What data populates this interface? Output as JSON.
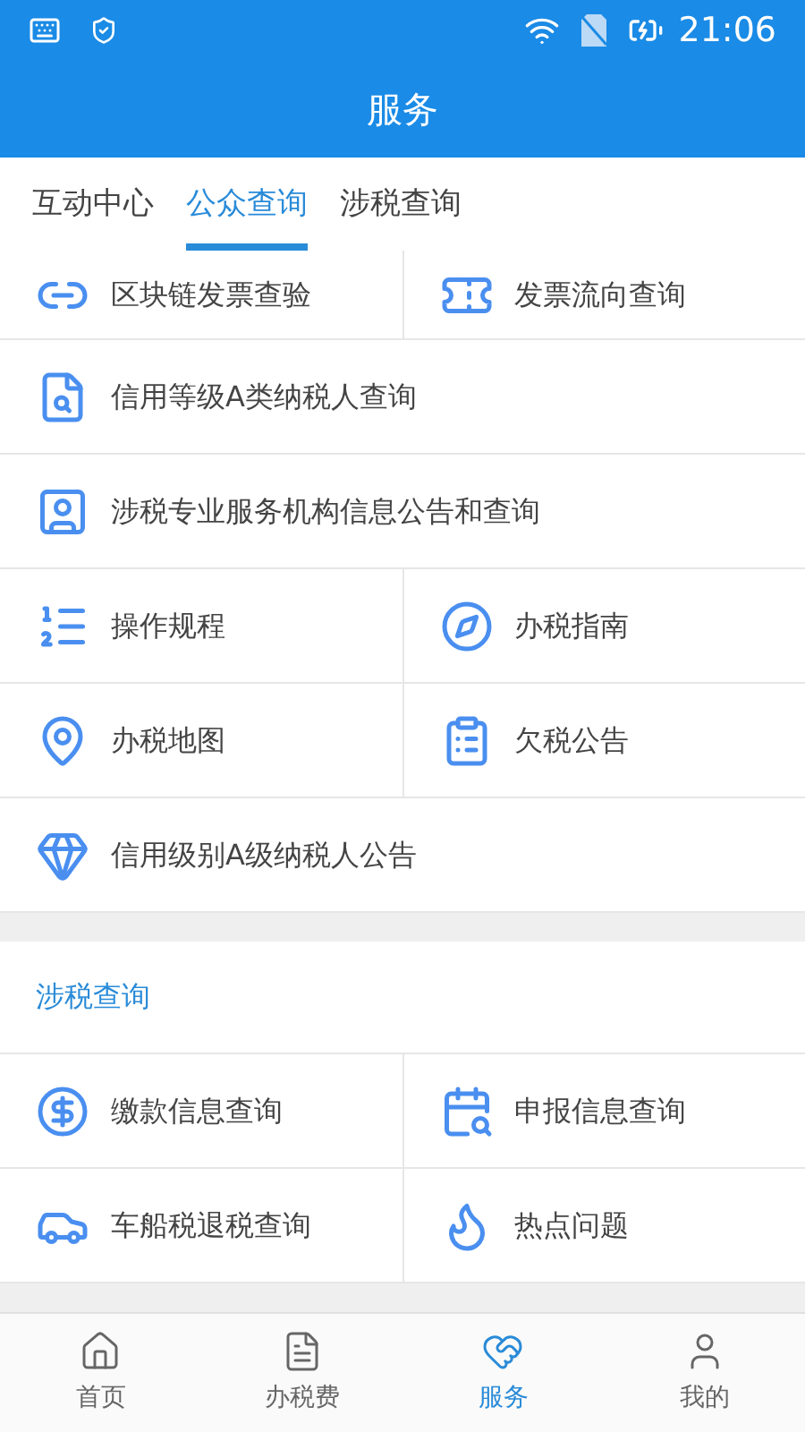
{
  "status_bar": {
    "time": "21:06"
  },
  "header": {
    "title": "服务"
  },
  "tabs": [
    {
      "label": "互动中心",
      "selected": false
    },
    {
      "label": "公众查询",
      "selected": true
    },
    {
      "label": "涉税查询",
      "selected": false
    }
  ],
  "sections": [
    {
      "rows": [
        {
          "items": [
            {
              "label": "区块链发票查验"
            },
            {
              "label": "发票流向查询"
            }
          ]
        },
        {
          "items": [
            {
              "label": "信用等级A类纳税人查询"
            }
          ]
        },
        {
          "items": [
            {
              "label": "涉税专业服务机构信息公告和查询"
            }
          ]
        },
        {
          "items": [
            {
              "label": "操作规程"
            },
            {
              "label": "办税指南"
            }
          ]
        },
        {
          "items": [
            {
              "label": "办税地图"
            },
            {
              "label": "欠税公告"
            }
          ]
        },
        {
          "items": [
            {
              "label": "信用级别A级纳税人公告"
            }
          ]
        }
      ]
    },
    {
      "title": "涉税查询",
      "rows": [
        {
          "items": [
            {
              "label": "缴款信息查询"
            },
            {
              "label": "申报信息查询"
            }
          ]
        },
        {
          "items": [
            {
              "label": "车船税退税查询"
            },
            {
              "label": "热点问题"
            }
          ]
        }
      ]
    }
  ],
  "bottom_nav": [
    {
      "label": "首页",
      "selected": false
    },
    {
      "label": "办税费",
      "selected": false
    },
    {
      "label": "服务",
      "selected": true
    },
    {
      "label": "我的",
      "selected": false
    }
  ]
}
